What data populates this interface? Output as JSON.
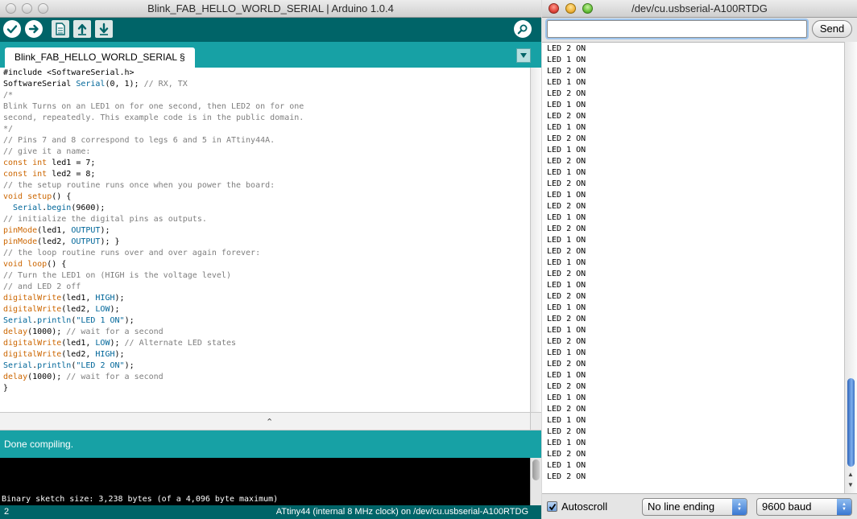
{
  "ide": {
    "window_title": "Blink_FAB_HELLO_WORLD_SERIAL | Arduino 1.0.4",
    "tab_label": "Blink_FAB_HELLO_WORLD_SERIAL §",
    "status_message": "Done compiling.",
    "console_text": "Binary sketch size: 3,238 bytes (of a 4,096 byte maximum)",
    "line_number": "2",
    "board_info": "ATtiny44 (internal 8 MHz clock) on /dev/cu.usbserial-A100RTDG",
    "code_lines": [
      "#include <SoftwareSerial.h>",
      "SoftwareSerial Serial(0, 1); // RX, TX",
      "/*",
      "Blink Turns on an LED1 on for one second, then LED2 on for one",
      "second, repeatedly. This example code is in the public domain.",
      "*/",
      "// Pins 7 and 8 correspond to legs 6 and 5 in ATtiny44A.",
      "// give it a name:",
      "const int led1 = 7;",
      "const int led2 = 8;",
      "// the setup routine runs once when you power the board:",
      "void setup() {",
      "  Serial.begin(9600);",
      "// initialize the digital pins as outputs.",
      "pinMode(led1, OUTPUT);",
      "pinMode(led2, OUTPUT); }",
      "// the loop routine runs over and over again forever:",
      "void loop() {",
      "// Turn the LED1 on (HIGH is the voltage level)",
      "// and LED 2 off",
      "digitalWrite(led1, HIGH);",
      "digitalWrite(led2, LOW);",
      "Serial.println(\"LED 1 ON\");",
      "delay(1000); // wait for a second",
      "digitalWrite(led1, LOW); // Alternate LED states",
      "digitalWrite(led2, HIGH);",
      "Serial.println(\"LED 2 ON\");",
      "delay(1000); // wait for a second",
      "}"
    ],
    "colors": {
      "toolbar": "#006468",
      "tabbar": "#17a1a5",
      "keyword": "#cc6600",
      "builtin": "#006699",
      "comment": "#7e7e7e"
    },
    "toolbar_buttons": [
      {
        "name": "verify",
        "icon": "check-icon"
      },
      {
        "name": "upload",
        "icon": "arrow-right-icon"
      },
      {
        "name": "new",
        "icon": "new-document-icon"
      },
      {
        "name": "open",
        "icon": "arrow-up-icon"
      },
      {
        "name": "save",
        "icon": "arrow-down-icon"
      },
      {
        "name": "serial-monitor",
        "icon": "magnifier-icon"
      }
    ]
  },
  "serial": {
    "window_title": "/dev/cu.usbserial-A100RTDG",
    "input_value": "",
    "send_label": "Send",
    "autoscroll_label": "Autoscroll",
    "autoscroll_checked": true,
    "line_ending": "No line ending",
    "baud": "9600 baud",
    "output_lines": [
      "LED 1 ON",
      "LED 2 ON",
      "LED 1 ON",
      "LED 2 ON",
      "LED 1 ON",
      "LED 2 ON",
      "LED 1 ON",
      "LED 2 ON",
      "LED 1 ON",
      "LED 2 ON",
      "LED 1 ON",
      "LED 2 ON",
      "LED 1 ON",
      "LED 2 ON",
      "LED 1 ON",
      "LED 2 ON",
      "LED 1 ON",
      "LED 2 ON",
      "LED 1 ON",
      "LED 2 ON",
      "LED 1 ON",
      "LED 2 ON",
      "LED 1 ON",
      "LED 2 ON",
      "LED 1 ON",
      "LED 2 ON",
      "LED 1 ON",
      "LED 2 ON",
      "LED 1 ON",
      "LED 2 ON",
      "LED 1 ON",
      "LED 2 ON",
      "LED 1 ON",
      "LED 2 ON",
      "LED 1 ON",
      "LED 2 ON",
      "LED 1 ON",
      "LED 2 ON",
      "LED 1 ON",
      "LED 2 ON"
    ]
  }
}
